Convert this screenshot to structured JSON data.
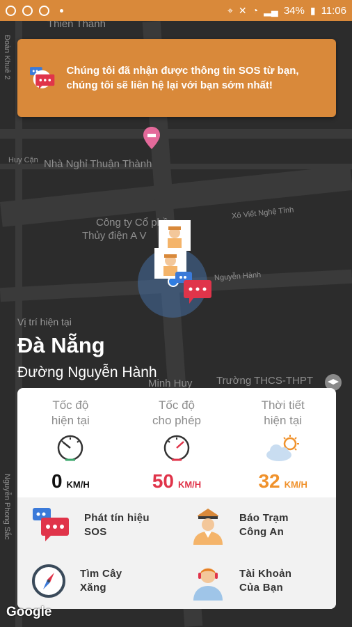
{
  "status_bar": {
    "battery": "34%",
    "time": "11:06"
  },
  "map": {
    "labels": {
      "thien_thanh": "Thiên Thành",
      "huy_can": "Huy Cận",
      "nha_nghi": "Nhà Nghỉ Thuận Thành",
      "xo_viet": "Xô Viết Nghệ Tĩnh",
      "cong_ty_1": "Công ty Cổ phần",
      "cong_ty_2": "Thủy điện A V",
      "nguyen_hanh_road": "Nguyễn Hành",
      "minh_huy": "Minh Huy",
      "truong": "Trường THCS-THPT",
      "side_left_top": "Đoàn Khuê 2",
      "side_left_bottom": "Nguyễn Phong Sắc"
    },
    "google": "Google"
  },
  "banner": {
    "message": "Chúng tôi đã nhận được thông tin SOS từ bạn, chúng tôi sẽ liên hệ lại với bạn sớm nhất!"
  },
  "location": {
    "caption": "Vị trí hiện tại",
    "city": "Đà Nẵng",
    "street": "Đường Nguyễn Hành"
  },
  "stats": {
    "current_speed": {
      "label_1": "Tốc độ",
      "label_2": "hiện tại",
      "value": "0",
      "unit": "KM/H",
      "color": "#111111"
    },
    "speed_limit": {
      "label_1": "Tốc độ",
      "label_2": "cho phép",
      "value": "50",
      "unit": "KM/H",
      "color": "#e0344a"
    },
    "weather": {
      "label_1": "Thời tiết",
      "label_2": "hiện tại",
      "value": "32",
      "unit": "KM/H",
      "color": "#f0922c"
    }
  },
  "actions": {
    "sos": {
      "line1": "Phát tín hiệu",
      "line2": "SOS"
    },
    "police": {
      "line1": "Báo Trạm",
      "line2": "Công An"
    },
    "gas": {
      "line1": "Tìm Cây",
      "line2": "Xăng"
    },
    "account": {
      "line1": "Tài Khoản",
      "line2": "Của Bạn"
    }
  },
  "colors": {
    "accent": "#d9893a",
    "map_bg": "#2c2c2c",
    "sos_blue": "#3b7ad9",
    "sos_red": "#e0344a"
  }
}
